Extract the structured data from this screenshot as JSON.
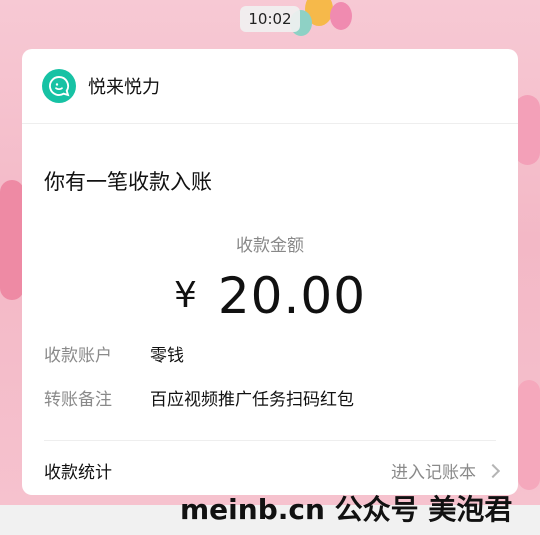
{
  "status_bar": {
    "time": "10:02"
  },
  "card": {
    "app_name": "悦来悦力",
    "notice_title": "你有一笔收款入账",
    "amount_label": "收款金额",
    "currency": "¥",
    "amount": "20.00",
    "details": [
      {
        "key": "收款账户",
        "value": "零钱"
      },
      {
        "key": "转账备注",
        "value": "百应视频推广任务扫码红包"
      }
    ],
    "footer_left": "收款统计",
    "footer_right": "进入记账本"
  },
  "watermark": "meinb.cn  公众号 美泡君",
  "icons": {
    "logo": "chat-bubble-icon",
    "chevron": "chevron-right-icon"
  },
  "colors": {
    "brand": "#17c2a4",
    "background": "#f3b8c6"
  }
}
